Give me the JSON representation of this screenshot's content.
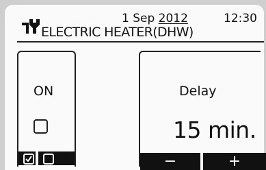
{
  "header": {
    "date_day_month": "1 Sep ",
    "date_year": "2012",
    "time": "12:30",
    "title": "ELECTRIC HEATER(DHW)",
    "icon": "wrench-icon"
  },
  "left_panel": {
    "status_label": "ON",
    "checkbox_checked": false,
    "bar": {
      "checked_box": true,
      "unchecked_box": false
    }
  },
  "right_panel": {
    "label": "Delay",
    "value": "15 min."
  },
  "buttons": {
    "minus": "−",
    "plus": "+"
  },
  "colors": {
    "screen_bg": "#fafafa",
    "ink": "#111111",
    "bezel": "#cfcfcf"
  }
}
